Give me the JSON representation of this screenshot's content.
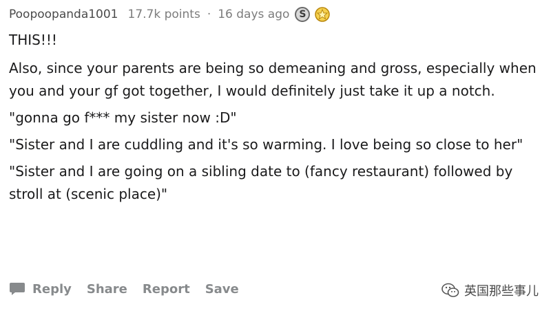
{
  "comment": {
    "username": "Poopoopanda1001",
    "points": "17.7k points",
    "separator": "·",
    "time_ago": "16 days ago",
    "awards": [
      {
        "icon": "silver-award-icon",
        "glyph": "S",
        "color": "#c0c0c0"
      },
      {
        "icon": "gold-award-icon",
        "color": "#f5c518"
      }
    ],
    "paragraphs": [
      "THIS!!!",
      "Also, since your parents are being so demeaning and gross, especially when you and your gf got together, I would definitely just take it up a notch.",
      "\"gonna go f*** my sister now :D\"",
      "\"Sister and I are cuddling and it's so warming. I love being so close to her\"",
      "\"Sister and I are going on a sibling date to (fancy restaurant) followed by stroll at (scenic place)\""
    ]
  },
  "actions": {
    "reply_label": "Reply",
    "share_label": "Share",
    "report_label": "Report",
    "save_label": "Save",
    "reply_icon": "comment-bubble-icon"
  },
  "watermark": {
    "icon": "wechat-icon",
    "text": "英国那些事儿"
  }
}
